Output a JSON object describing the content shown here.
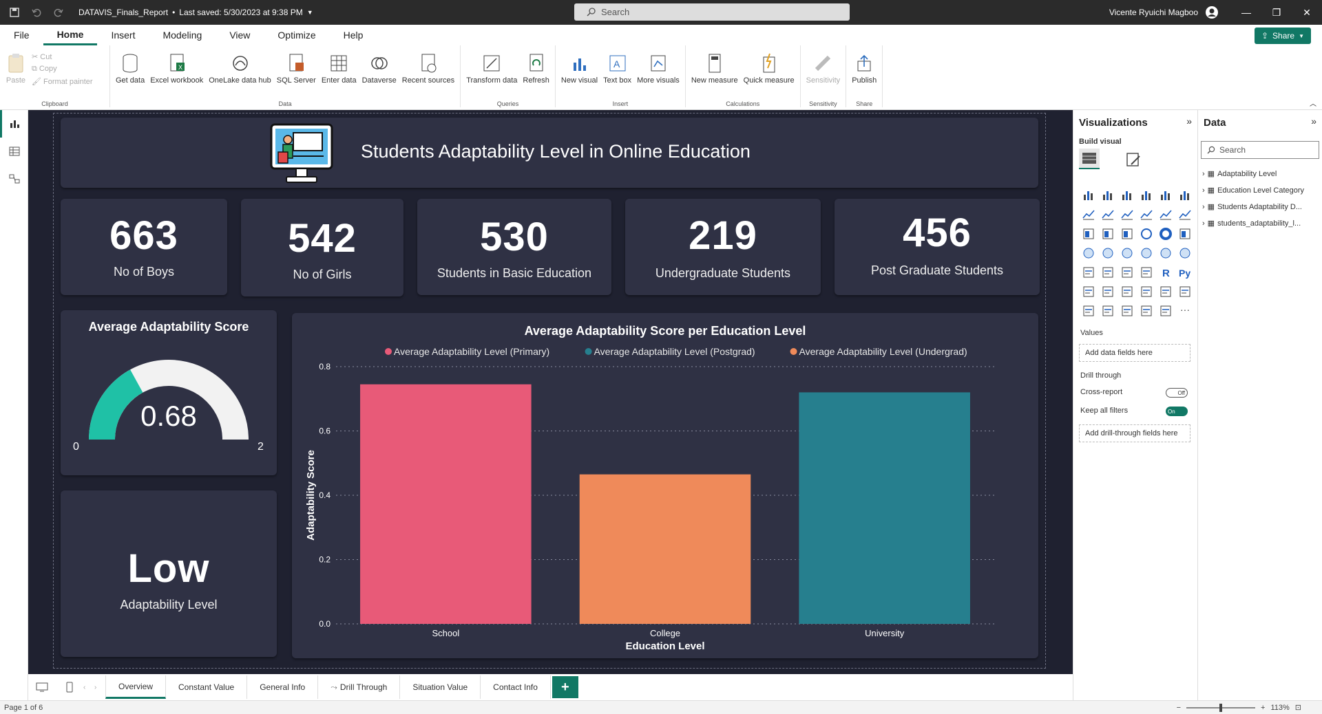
{
  "titlebar": {
    "doc_title": "DATAVIS_Finals_Report",
    "saved": "Last saved: 5/30/2023 at 9:38 PM",
    "search_placeholder": "Search",
    "user": "Vicente Ryuichi Magboo"
  },
  "menu": {
    "tabs": [
      "File",
      "Home",
      "Insert",
      "Modeling",
      "View",
      "Optimize",
      "Help"
    ],
    "active": "Home",
    "share": "Share"
  },
  "ribbon": {
    "clipboard": {
      "paste": "Paste",
      "cut": "Cut",
      "copy": "Copy",
      "format_painter": "Format painter",
      "label": "Clipboard"
    },
    "data": {
      "get_data": "Get data",
      "excel": "Excel workbook",
      "onelake": "OneLake data hub",
      "sql": "SQL Server",
      "enter": "Enter data",
      "dataverse": "Dataverse",
      "recent": "Recent sources",
      "label": "Data"
    },
    "queries": {
      "transform": "Transform data",
      "refresh": "Refresh",
      "label": "Queries"
    },
    "insert": {
      "new_visual": "New visual",
      "text_box": "Text box",
      "more_visuals": "More visuals",
      "label": "Insert"
    },
    "calculations": {
      "new_measure": "New measure",
      "quick_measure": "Quick measure",
      "label": "Calculations"
    },
    "sensitivity": {
      "sensitivity": "Sensitivity",
      "label": "Sensitivity"
    },
    "share": {
      "publish": "Publish",
      "label": "Share"
    }
  },
  "report": {
    "title": "Students Adaptability Level in Online Education",
    "kpis": [
      {
        "value": "663",
        "label": "No of Boys"
      },
      {
        "value": "542",
        "label": "No of Girls"
      },
      {
        "value": "530",
        "label": "Students in Basic Education"
      },
      {
        "value": "219",
        "label": "Undergraduate Students"
      },
      {
        "value": "456",
        "label": "Post Graduate Students"
      }
    ],
    "gauge": {
      "title": "Average Adaptability Score",
      "value": 0.68,
      "value_label": "0.68",
      "min_label": "0",
      "max_label": "2",
      "min": 0,
      "max": 2,
      "fill_color": "#1fc1a6",
      "track_color": "#f2f2f2"
    },
    "level": {
      "value": "Low",
      "label": "Adaptability Level"
    }
  },
  "chart_data": {
    "type": "bar",
    "title": "Average Adaptability Score per Education Level",
    "xlabel": "Education Level",
    "ylabel": "Adaptability Score",
    "categories": [
      "School",
      "College",
      "University"
    ],
    "series": [
      {
        "name": "Average Adaptability Level (Primary)",
        "color": "#e85a78",
        "values": [
          0.745,
          null,
          null
        ]
      },
      {
        "name": "Average Adaptability Level (Postgrad)",
        "color": "#267f8e",
        "values": [
          null,
          null,
          0.72
        ]
      },
      {
        "name": "Average Adaptability Level (Undergrad)",
        "color": "#ef8a5a",
        "values": [
          null,
          0.465,
          null
        ]
      }
    ],
    "ylim": [
      0,
      0.8
    ],
    "yticks": [
      "0.0",
      "0.2",
      "0.4",
      "0.6",
      "0.8"
    ],
    "grid": true,
    "legend": "top"
  },
  "pages": {
    "tabs": [
      "Overview",
      "Constant Value",
      "General Info",
      "Drill Through",
      "Situation Value",
      "Contact Info"
    ],
    "active": "Overview",
    "page_count": "Page 1 of 6",
    "zoom": "113%"
  },
  "viz_pane": {
    "title": "Visualizations",
    "build_visual": "Build visual",
    "values": "Values",
    "add_data_fields": "Add data fields here",
    "drill_through": "Drill through",
    "cross_report": "Cross-report",
    "cross_report_state": "Off",
    "keep_all_filters": "Keep all filters",
    "keep_all_filters_state": "On",
    "add_drill_fields": "Add drill-through fields here"
  },
  "data_pane": {
    "title": "Data",
    "search_placeholder": "Search",
    "tables": [
      "Adaptability Level",
      "Education Level Category",
      "Students Adaptability D...",
      "students_adaptability_l..."
    ]
  }
}
